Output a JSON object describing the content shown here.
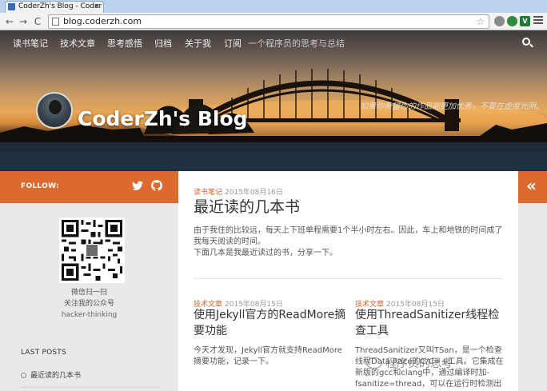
{
  "browser": {
    "tab_title": "CoderZh's Blog - Coder",
    "tab_close": "×",
    "url": "blog.coderzh.com",
    "back": "←",
    "forward": "→",
    "reload": "C",
    "star": "☆",
    "ext_v": "V"
  },
  "nav": {
    "items": [
      "读书笔记",
      "技术文章",
      "思考感悟",
      "归档",
      "关于我",
      "订阅"
    ],
    "tagline": "一个程序员的思考与总结"
  },
  "banner": {
    "blog_title": "CoderZh's Blog",
    "subtitle": "如果你希望你的作品能更加优秀，不要在虚度光阴。"
  },
  "sidebar": {
    "follow_label": "FOLLOW:",
    "wechat_line1": "微信扫一扫",
    "wechat_line2": "关注我的公众号",
    "wechat_id": "hacker-thinking",
    "last_posts_label": "LAST POSTS",
    "last_posts": [
      "最近读的几本书"
    ]
  },
  "posts": {
    "featured": {
      "category": "读书笔记",
      "date": "2015年08月16日",
      "title": "最近读的几本书",
      "excerpt_1": "由于我住的比较远，每天上下班单程需要1个半小时左右。因此，车上和地铁的时间成了我每天阅读的时间。",
      "excerpt_2": "下面几本是我最近读过的书，分享一下。"
    },
    "left": {
      "category": "技术文章",
      "date": "2015年08月15日",
      "title": "使用Jekyll官方的ReadMore摘要功能",
      "excerpt": "今天才发现，Jekyll官方就支持ReadMore摘要功能，记录一下。"
    },
    "right": {
      "category": "技术文章",
      "date": "2015年08月15日",
      "title": "使用ThreadSanitizer线程检查工具",
      "excerpt": "ThreadSanitizer又叫TSan，是一个检查线程Data Race的C/C++工具。它集成在新版的gcc和clang中，通过编译时加-fsanitize=thread，可以在运行时检测出"
    }
  },
  "collapse_label": "«",
  "watermark": "程序员的思考",
  "colors": {
    "accent": "#dc6a2f",
    "sidebar_bg": "#e9e9e9"
  },
  "icons": [
    "twitter-icon",
    "github-icon",
    "search-icon",
    "avatar",
    "qr-code"
  ]
}
